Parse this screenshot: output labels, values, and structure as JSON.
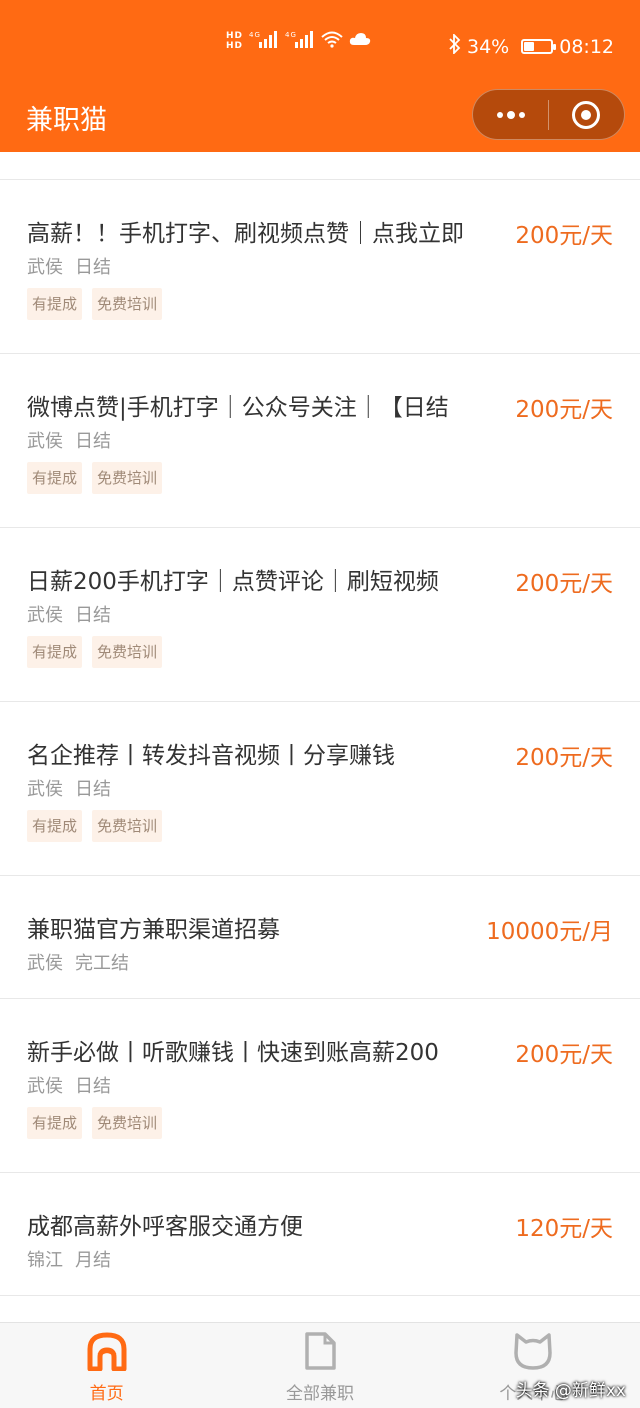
{
  "status_bar": {
    "hd1": "HD",
    "hd2": "HD",
    "net1": "4G",
    "net2": "4G",
    "battery": "34%",
    "battery_level": 0.34,
    "time": "08:12"
  },
  "header": {
    "title": "兼职猫"
  },
  "jobs": [
    {
      "title": "高薪！！手机打字、刷视频点赞｜点我立即",
      "salary": "200元/天",
      "location": "武侯",
      "settlement": "日结",
      "tags": [
        "有提成",
        "免费培训"
      ]
    },
    {
      "title": "微博点赞|手机打字｜公众号关注｜【日结",
      "salary": "200元/天",
      "location": "武侯",
      "settlement": "日结",
      "tags": [
        "有提成",
        "免费培训"
      ]
    },
    {
      "title": "日薪200手机打字｜点赞评论｜刷短视频",
      "salary": "200元/天",
      "location": "武侯",
      "settlement": "日结",
      "tags": [
        "有提成",
        "免费培训"
      ]
    },
    {
      "title": "名企推荐丨转发抖音视频丨分享赚钱",
      "salary": "200元/天",
      "location": "武侯",
      "settlement": "日结",
      "tags": [
        "有提成",
        "免费培训"
      ]
    },
    {
      "title": "兼职猫官方兼职渠道招募",
      "salary": "10000元/月",
      "location": "武侯",
      "settlement": "完工结",
      "tags": []
    },
    {
      "title": "新手必做丨听歌赚钱丨快速到账高薪200",
      "salary": "200元/天",
      "location": "武侯",
      "settlement": "日结",
      "tags": [
        "有提成",
        "免费培训"
      ]
    },
    {
      "title": "成都高薪外呼客服交通方便",
      "salary": "120元/天",
      "location": "锦江",
      "settlement": "月结",
      "tags": []
    }
  ],
  "tabbar": {
    "tabs": [
      {
        "label": "首页",
        "active": true
      },
      {
        "label": "全部兼职",
        "active": false
      },
      {
        "label": "个人中心",
        "active": false
      }
    ]
  },
  "watermark": "头条 @新鲜xx",
  "colors": {
    "brand": "#ff6a13",
    "salary": "#ee6b1f"
  }
}
